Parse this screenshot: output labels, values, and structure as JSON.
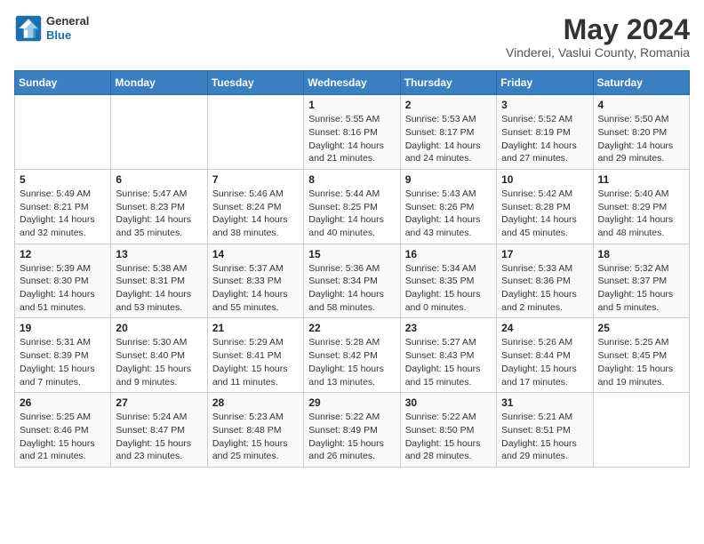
{
  "header": {
    "logo_line1": "General",
    "logo_line2": "Blue",
    "title": "May 2024",
    "subtitle": "Vinderei, Vaslui County, Romania"
  },
  "days_of_week": [
    "Sunday",
    "Monday",
    "Tuesday",
    "Wednesday",
    "Thursday",
    "Friday",
    "Saturday"
  ],
  "weeks": [
    [
      {
        "day": "",
        "sunrise": "",
        "sunset": "",
        "daylight": ""
      },
      {
        "day": "",
        "sunrise": "",
        "sunset": "",
        "daylight": ""
      },
      {
        "day": "",
        "sunrise": "",
        "sunset": "",
        "daylight": ""
      },
      {
        "day": "1",
        "sunrise": "Sunrise: 5:55 AM",
        "sunset": "Sunset: 8:16 PM",
        "daylight": "Daylight: 14 hours and 21 minutes."
      },
      {
        "day": "2",
        "sunrise": "Sunrise: 5:53 AM",
        "sunset": "Sunset: 8:17 PM",
        "daylight": "Daylight: 14 hours and 24 minutes."
      },
      {
        "day": "3",
        "sunrise": "Sunrise: 5:52 AM",
        "sunset": "Sunset: 8:19 PM",
        "daylight": "Daylight: 14 hours and 27 minutes."
      },
      {
        "day": "4",
        "sunrise": "Sunrise: 5:50 AM",
        "sunset": "Sunset: 8:20 PM",
        "daylight": "Daylight: 14 hours and 29 minutes."
      }
    ],
    [
      {
        "day": "5",
        "sunrise": "Sunrise: 5:49 AM",
        "sunset": "Sunset: 8:21 PM",
        "daylight": "Daylight: 14 hours and 32 minutes."
      },
      {
        "day": "6",
        "sunrise": "Sunrise: 5:47 AM",
        "sunset": "Sunset: 8:23 PM",
        "daylight": "Daylight: 14 hours and 35 minutes."
      },
      {
        "day": "7",
        "sunrise": "Sunrise: 5:46 AM",
        "sunset": "Sunset: 8:24 PM",
        "daylight": "Daylight: 14 hours and 38 minutes."
      },
      {
        "day": "8",
        "sunrise": "Sunrise: 5:44 AM",
        "sunset": "Sunset: 8:25 PM",
        "daylight": "Daylight: 14 hours and 40 minutes."
      },
      {
        "day": "9",
        "sunrise": "Sunrise: 5:43 AM",
        "sunset": "Sunset: 8:26 PM",
        "daylight": "Daylight: 14 hours and 43 minutes."
      },
      {
        "day": "10",
        "sunrise": "Sunrise: 5:42 AM",
        "sunset": "Sunset: 8:28 PM",
        "daylight": "Daylight: 14 hours and 45 minutes."
      },
      {
        "day": "11",
        "sunrise": "Sunrise: 5:40 AM",
        "sunset": "Sunset: 8:29 PM",
        "daylight": "Daylight: 14 hours and 48 minutes."
      }
    ],
    [
      {
        "day": "12",
        "sunrise": "Sunrise: 5:39 AM",
        "sunset": "Sunset: 8:30 PM",
        "daylight": "Daylight: 14 hours and 51 minutes."
      },
      {
        "day": "13",
        "sunrise": "Sunrise: 5:38 AM",
        "sunset": "Sunset: 8:31 PM",
        "daylight": "Daylight: 14 hours and 53 minutes."
      },
      {
        "day": "14",
        "sunrise": "Sunrise: 5:37 AM",
        "sunset": "Sunset: 8:33 PM",
        "daylight": "Daylight: 14 hours and 55 minutes."
      },
      {
        "day": "15",
        "sunrise": "Sunrise: 5:36 AM",
        "sunset": "Sunset: 8:34 PM",
        "daylight": "Daylight: 14 hours and 58 minutes."
      },
      {
        "day": "16",
        "sunrise": "Sunrise: 5:34 AM",
        "sunset": "Sunset: 8:35 PM",
        "daylight": "Daylight: 15 hours and 0 minutes."
      },
      {
        "day": "17",
        "sunrise": "Sunrise: 5:33 AM",
        "sunset": "Sunset: 8:36 PM",
        "daylight": "Daylight: 15 hours and 2 minutes."
      },
      {
        "day": "18",
        "sunrise": "Sunrise: 5:32 AM",
        "sunset": "Sunset: 8:37 PM",
        "daylight": "Daylight: 15 hours and 5 minutes."
      }
    ],
    [
      {
        "day": "19",
        "sunrise": "Sunrise: 5:31 AM",
        "sunset": "Sunset: 8:39 PM",
        "daylight": "Daylight: 15 hours and 7 minutes."
      },
      {
        "day": "20",
        "sunrise": "Sunrise: 5:30 AM",
        "sunset": "Sunset: 8:40 PM",
        "daylight": "Daylight: 15 hours and 9 minutes."
      },
      {
        "day": "21",
        "sunrise": "Sunrise: 5:29 AM",
        "sunset": "Sunset: 8:41 PM",
        "daylight": "Daylight: 15 hours and 11 minutes."
      },
      {
        "day": "22",
        "sunrise": "Sunrise: 5:28 AM",
        "sunset": "Sunset: 8:42 PM",
        "daylight": "Daylight: 15 hours and 13 minutes."
      },
      {
        "day": "23",
        "sunrise": "Sunrise: 5:27 AM",
        "sunset": "Sunset: 8:43 PM",
        "daylight": "Daylight: 15 hours and 15 minutes."
      },
      {
        "day": "24",
        "sunrise": "Sunrise: 5:26 AM",
        "sunset": "Sunset: 8:44 PM",
        "daylight": "Daylight: 15 hours and 17 minutes."
      },
      {
        "day": "25",
        "sunrise": "Sunrise: 5:25 AM",
        "sunset": "Sunset: 8:45 PM",
        "daylight": "Daylight: 15 hours and 19 minutes."
      }
    ],
    [
      {
        "day": "26",
        "sunrise": "Sunrise: 5:25 AM",
        "sunset": "Sunset: 8:46 PM",
        "daylight": "Daylight: 15 hours and 21 minutes."
      },
      {
        "day": "27",
        "sunrise": "Sunrise: 5:24 AM",
        "sunset": "Sunset: 8:47 PM",
        "daylight": "Daylight: 15 hours and 23 minutes."
      },
      {
        "day": "28",
        "sunrise": "Sunrise: 5:23 AM",
        "sunset": "Sunset: 8:48 PM",
        "daylight": "Daylight: 15 hours and 25 minutes."
      },
      {
        "day": "29",
        "sunrise": "Sunrise: 5:22 AM",
        "sunset": "Sunset: 8:49 PM",
        "daylight": "Daylight: 15 hours and 26 minutes."
      },
      {
        "day": "30",
        "sunrise": "Sunrise: 5:22 AM",
        "sunset": "Sunset: 8:50 PM",
        "daylight": "Daylight: 15 hours and 28 minutes."
      },
      {
        "day": "31",
        "sunrise": "Sunrise: 5:21 AM",
        "sunset": "Sunset: 8:51 PM",
        "daylight": "Daylight: 15 hours and 29 minutes."
      },
      {
        "day": "",
        "sunrise": "",
        "sunset": "",
        "daylight": ""
      }
    ]
  ]
}
